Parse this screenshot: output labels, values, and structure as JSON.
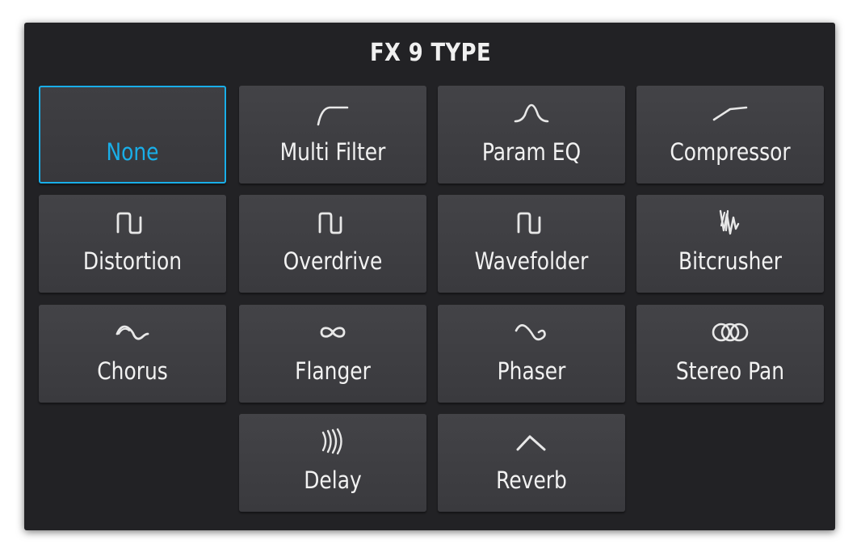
{
  "dialog": {
    "title": "FX 9 TYPE",
    "accent_color": "#19aee8",
    "background_color": "#222225",
    "button_color": "#3f3f43"
  },
  "fx_types": [
    {
      "label": "None",
      "icon": "none",
      "selected": true
    },
    {
      "label": "Multi Filter",
      "icon": "lowpass-filter-curve-icon",
      "selected": false
    },
    {
      "label": "Param EQ",
      "icon": "bell-curve-icon",
      "selected": false
    },
    {
      "label": "Compressor",
      "icon": "compressor-curve-icon",
      "selected": false
    },
    {
      "label": "Distortion",
      "icon": "square-wave-icon",
      "selected": false
    },
    {
      "label": "Overdrive",
      "icon": "square-wave-icon",
      "selected": false
    },
    {
      "label": "Wavefolder",
      "icon": "square-wave-icon",
      "selected": false
    },
    {
      "label": "Bitcrusher",
      "icon": "bitcrush-zigzag-icon",
      "selected": false
    },
    {
      "label": "Chorus",
      "icon": "sine-wave-icon",
      "selected": false
    },
    {
      "label": "Flanger",
      "icon": "infinity-icon",
      "selected": false
    },
    {
      "label": "Phaser",
      "icon": "sine-wave-icon",
      "selected": false
    },
    {
      "label": "Stereo Pan",
      "icon": "three-circles-icon",
      "selected": false
    },
    {
      "label": "Delay",
      "icon": "echo-arcs-icon",
      "selected": false
    },
    {
      "label": "Reverb",
      "icon": "caret-up-icon",
      "selected": false
    }
  ]
}
